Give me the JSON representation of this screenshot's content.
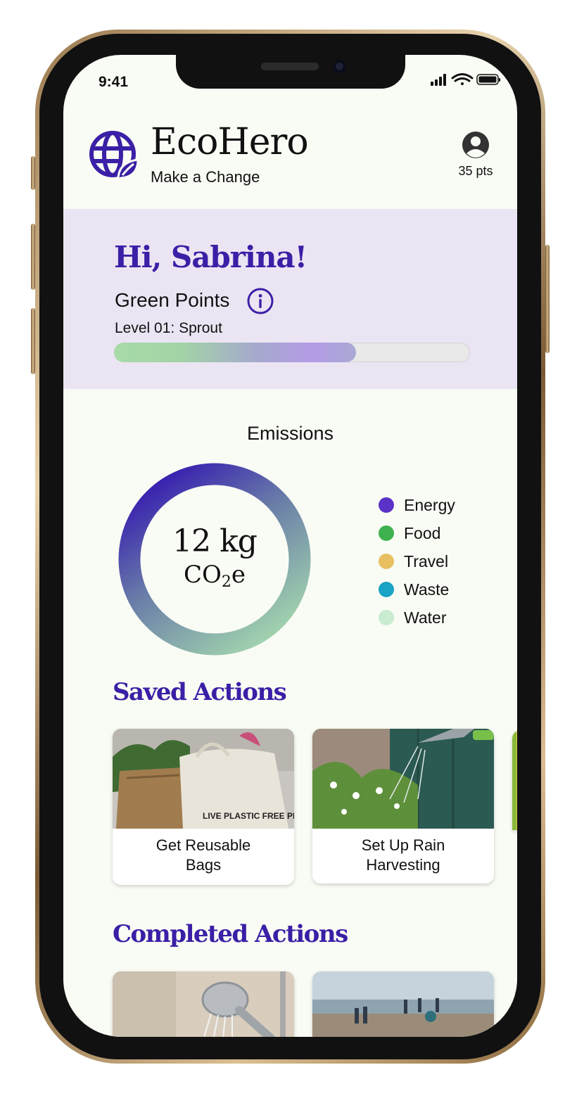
{
  "status_bar": {
    "time": "9:41"
  },
  "header": {
    "brand_name": "EcoHero",
    "tagline": "Make a Change",
    "points": "35 pts"
  },
  "greeting": {
    "text": "Hi, Sabrina!",
    "green_points_label": "Green Points",
    "level": "Level 01: Sprout",
    "progress_fraction": 0.68
  },
  "emissions": {
    "title": "Emissions",
    "value": "12 kg",
    "unit_main": "CO",
    "unit_sub": "2",
    "unit_tail": "e",
    "legend": [
      {
        "label": "Energy",
        "color": "#5a32c8"
      },
      {
        "label": "Food",
        "color": "#3fb24f"
      },
      {
        "label": "Travel",
        "color": "#e8c062"
      },
      {
        "label": "Waste",
        "color": "#1aa3c4"
      },
      {
        "label": "Water",
        "color": "#c9ebd0"
      }
    ]
  },
  "saved_actions": {
    "title": "Saved Actions",
    "cards": [
      {
        "line1": "Get Reusable",
        "line2": "Bags",
        "image_text": "LIVE PLASTIC FREE PLASTIC IS POISON"
      },
      {
        "line1": "Set Up Rain",
        "line2": "Harvesting"
      }
    ]
  },
  "completed_actions": {
    "title": "Completed Actions"
  },
  "colors": {
    "brand_purple": "#3b1fa6",
    "panel": "#ebe5f3",
    "background": "#f9fcf5"
  }
}
